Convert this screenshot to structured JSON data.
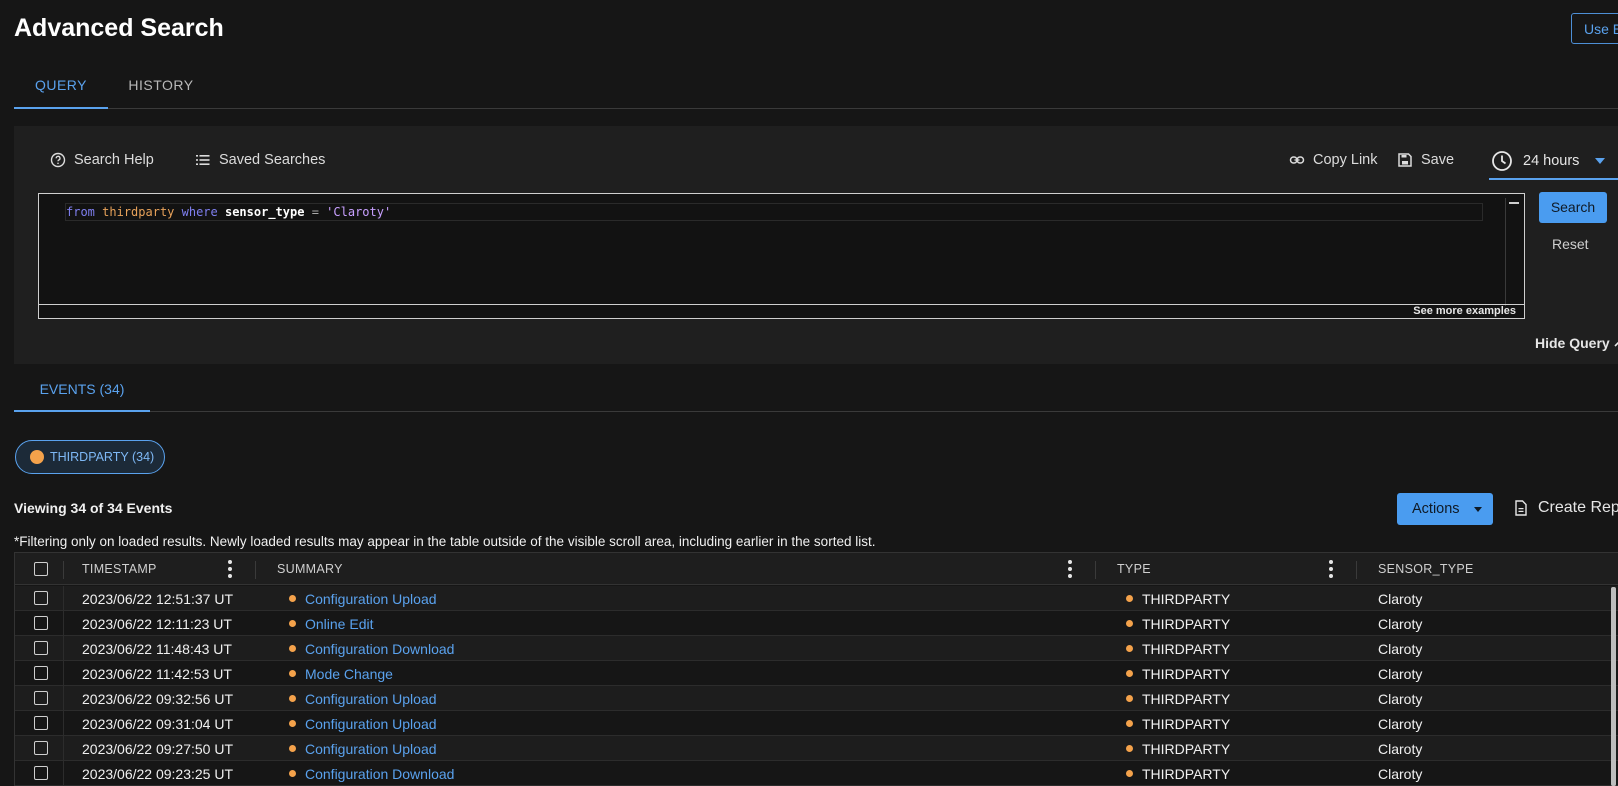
{
  "page": {
    "title": "Advanced Search",
    "top_button_label": "Use E"
  },
  "tabs": [
    {
      "label": "QUERY"
    },
    {
      "label": "HISTORY"
    }
  ],
  "toolbar": {
    "search_help": "Search Help",
    "saved_searches": "Saved Searches",
    "copy_link": "Copy Link",
    "save": "Save",
    "time_range": "24 hours"
  },
  "query": {
    "tokens": {
      "from": "from",
      "table": "thirdparty",
      "where": "where",
      "field": "sensor_type",
      "op": "=",
      "value": "'Claroty'"
    },
    "see_more": "See more examples",
    "search_label": "Search",
    "reset_label": "Reset",
    "hide_label": "Hide Query"
  },
  "events": {
    "tab_label": "EVENTS (34)",
    "chip_label": "THIRDPARTY (34)",
    "viewing": "Viewing 34 of 34 Events",
    "actions_label": "Actions",
    "create_report": "Create Rep",
    "filter_note": "*Filtering only on loaded results.  Newly loaded results may appear in the table outside of the visible scroll area, including earlier in the sorted list."
  },
  "table": {
    "columns": [
      "TIMESTAMP",
      "SUMMARY",
      "TYPE",
      "SENSOR_TYPE"
    ],
    "rows": [
      {
        "timestamp": "2023/06/22 12:51:37 UT",
        "summary": "Configuration Upload",
        "type": "THIRDPARTY",
        "sensor": "Claroty"
      },
      {
        "timestamp": "2023/06/22 12:11:23 UT",
        "summary": "Online Edit",
        "type": "THIRDPARTY",
        "sensor": "Claroty"
      },
      {
        "timestamp": "2023/06/22 11:48:43 UT",
        "summary": "Configuration Download",
        "type": "THIRDPARTY",
        "sensor": "Claroty"
      },
      {
        "timestamp": "2023/06/22 11:42:53 UT",
        "summary": "Mode Change",
        "type": "THIRDPARTY",
        "sensor": "Claroty"
      },
      {
        "timestamp": "2023/06/22 09:32:56 UT",
        "summary": "Configuration Upload",
        "type": "THIRDPARTY",
        "sensor": "Claroty"
      },
      {
        "timestamp": "2023/06/22 09:31:04 UT",
        "summary": "Configuration Upload",
        "type": "THIRDPARTY",
        "sensor": "Claroty"
      },
      {
        "timestamp": "2023/06/22 09:27:50 UT",
        "summary": "Configuration Upload",
        "type": "THIRDPARTY",
        "sensor": "Claroty"
      },
      {
        "timestamp": "2023/06/22 09:23:25 UT",
        "summary": "Configuration Download",
        "type": "THIRDPARTY",
        "sensor": "Claroty"
      }
    ]
  },
  "colors": {
    "accent": "#4a9cf0",
    "link": "#5aa2ee",
    "event_dot": "#f4a24b",
    "background": "#161616",
    "panel": "#1f1f1f"
  },
  "icons": [
    "help-circle-icon",
    "list-icon",
    "link-icon",
    "save-icon",
    "clock-icon",
    "chevron-down-icon",
    "chevron-up-icon",
    "document-icon",
    "kebab-icon"
  ]
}
